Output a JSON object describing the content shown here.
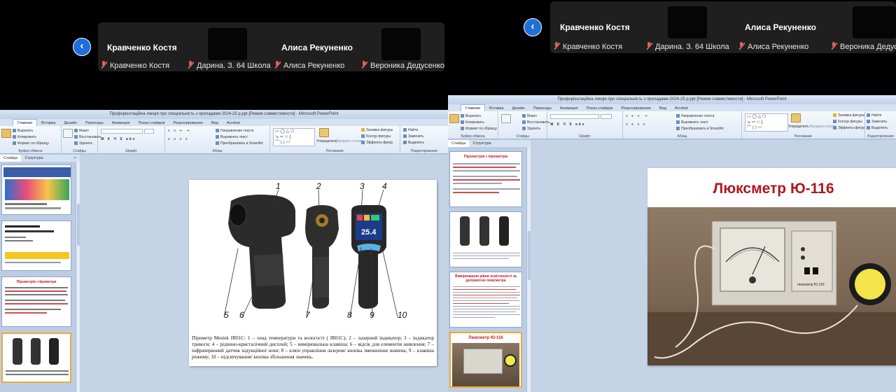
{
  "left_view": {
    "participants": [
      {
        "name": "Кравченко Костя"
      },
      {
        "name": "Алиса Рекуненко"
      }
    ],
    "muted_row": [
      {
        "name": "Кравченко Костя"
      },
      {
        "name": "Дарина. З. 64 Школа"
      },
      {
        "name": "Алиса Рекуненко"
      },
      {
        "name": "Вероника Дедусенко"
      }
    ],
    "powerpoint": {
      "title": "Профорієнтаційна лекція про спеціальність з приладами 2024-25 р.ppt [Режим совместимости] - Microsoft PowerPoint",
      "tabs": [
        "Главная",
        "Вставка",
        "Дизайн",
        "Переходы",
        "Анимация",
        "Показ слайдов",
        "Рецензирование",
        "Вид",
        "Acrobat"
      ],
      "active_tab": "Главная",
      "groups": {
        "clipboard": {
          "label": "Буфер обмена",
          "items": [
            "Вырезать",
            "Копировать",
            "Формат по образцу"
          ],
          "paste": "Вставить"
        },
        "slides": {
          "label": "Слайды",
          "items": [
            "Макет",
            "Восстановить",
            "Удалить"
          ],
          "create": "Создать слайд"
        },
        "font": {
          "label": "Шрифт"
        },
        "paragraph": {
          "label": "Абзац",
          "items": [
            "Направление текста",
            "Выровнять текст",
            "Преобразовать в SmartArt"
          ]
        },
        "drawing": {
          "label": "Рисование",
          "items": [
            "Заливка фигуры",
            "Контур фигуры",
            "Эффекты фигур"
          ],
          "arrange": "Упорядочить",
          "styles": "Экспресс-стили"
        },
        "editing": {
          "label": "Редактирование",
          "items": [
            "Найти",
            "Заменить",
            "Выделить"
          ]
        }
      },
      "pane_tabs": [
        "Слайды",
        "Структура"
      ],
      "slide_numbers": [
        "8",
        "9",
        "10",
        "11"
      ],
      "thumb_texts": {
        "t3_title": "Пірометрія і пірометри"
      },
      "slide": {
        "callouts": [
          "1",
          "2",
          "3",
          "4",
          "5",
          "6",
          "7",
          "8",
          "9",
          "10"
        ],
        "caption": "Пірометр Mestek IR01C: 1 – зонд температури та вологості ( IR01C); 2 – лазерний індикатор; 3 – індикатор тривоги; 4 – рідинно-кристалічний дисплей; 5 – вимірювальна клавіша; 6 – відсік для елементів живлення; 7 – інфрачервоний датчик індукційної зони; 8 – ключ управління лазером/ кнопка зменшення значень; 9 – клавіша режиму; 10 – підсвічування/ кнопка збільшення значень.",
        "device_screen": "25.4"
      }
    }
  },
  "right_view": {
    "participants": [
      {
        "name": "Кравченко Костя"
      },
      {
        "name": "Алиса Рекуненко"
      }
    ],
    "muted_row": [
      {
        "name": "Кравченко Костя"
      },
      {
        "name": "Дарина. З. 64 Школа"
      },
      {
        "name": "Алиса Рекуненко"
      },
      {
        "name": "Вероника Дедусе"
      }
    ],
    "powerpoint": {
      "title": "Профорієнтаційна лекція про спеціальність з приладами 2024-25 р.ppt [Режим совместимости] - Microsoft PowerPoint",
      "tabs": [
        "Главная",
        "Вставка",
        "Дизайн",
        "Переходы",
        "Анимация",
        "Показ слайдов",
        "Рецензирование",
        "Вид",
        "Acrobat"
      ],
      "active_tab": "Главная",
      "pane_tabs": [
        "Слайды",
        "Структура"
      ],
      "thumbs": {
        "t1_title": "Пірометрія і пірометри",
        "t3_title": "Вимірювання рівня освітленості за допомогою люксметра",
        "t4_title": "Люксметр Ю-116"
      },
      "slide": {
        "title": "Люксметр Ю-116",
        "meter_label": "люксметр Ю-116"
      }
    }
  },
  "colors": {
    "accent": "#1e6fd9",
    "slide_title_red": "#b0161e",
    "ribbon_bg": "#dfe9f6",
    "mic_off": "#e06060"
  }
}
